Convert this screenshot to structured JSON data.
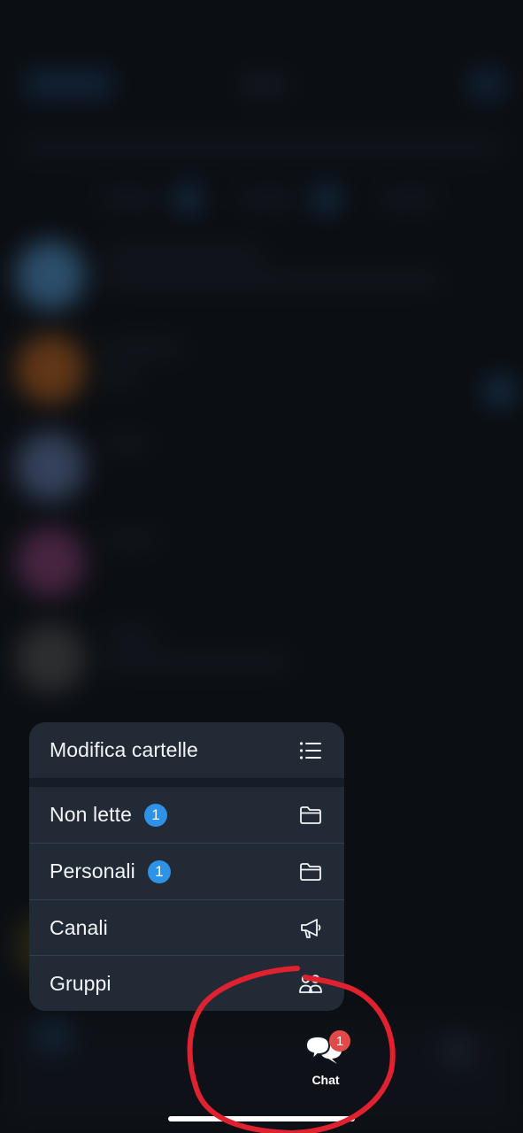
{
  "menu": {
    "edit_folders": "Modifica cartelle",
    "items": [
      {
        "label": "Non lette",
        "badge": "1",
        "icon": "folder-icon"
      },
      {
        "label": "Personali",
        "badge": "1",
        "icon": "folder-icon"
      },
      {
        "label": "Canali",
        "icon": "megaphone-icon"
      },
      {
        "label": "Gruppi",
        "icon": "group-icon"
      }
    ]
  },
  "tabbar": {
    "chat_label": "Chat",
    "chat_badge": "1"
  },
  "colors": {
    "menu_background": "#222a36",
    "badge_blue": "#2e92e6",
    "badge_red": "#e24a4a",
    "annotation_red": "#e0212f"
  }
}
